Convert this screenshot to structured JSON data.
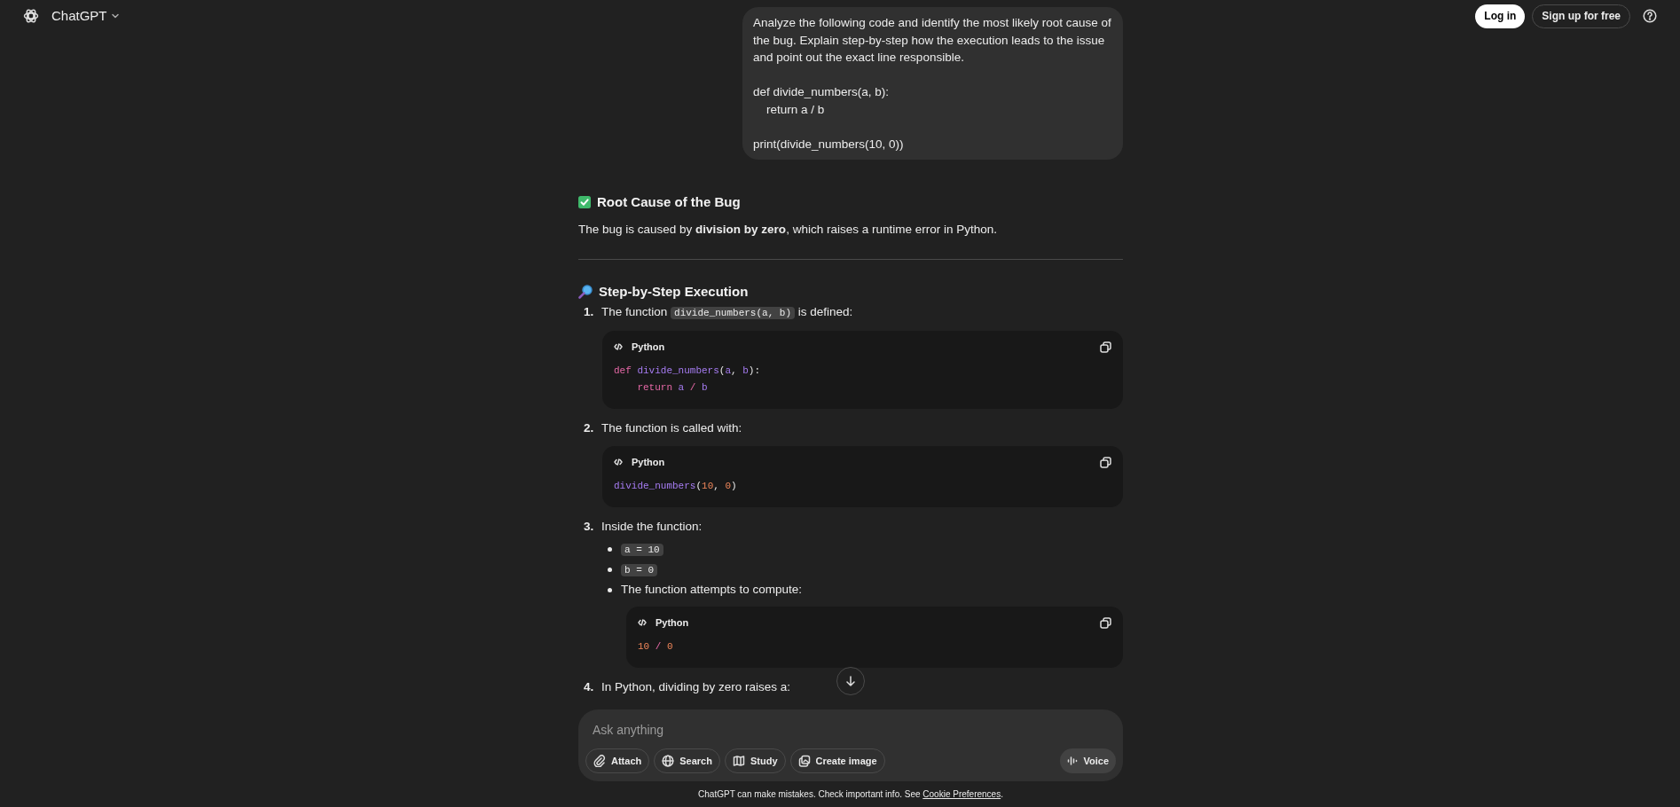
{
  "header": {
    "title": "ChatGPT",
    "login": "Log in",
    "signup": "Sign up for free"
  },
  "user_message": {
    "paragraphs": [
      "Analyze the following code and identify the most likely root cause of the bug. Explain step-by-step how the execution leads to the issue and point out the exact line responsible.",
      "def divide_numbers(a, b):\n    return a / b",
      "print(divide_numbers(10, 0))"
    ]
  },
  "sections": [
    {
      "kind": "check",
      "heading": "Root Cause of the Bug",
      "body": "The bug is caused by **division by zero**, which raises a runtime error in Python.",
      "divider": true
    },
    {
      "kind": "magnifier",
      "heading": "Step-by-Step Execution",
      "divider": false,
      "steps": [
        {
          "number": "1.",
          "parts": [
            {
              "kind": "text",
              "text": "The function "
            },
            {
              "kind": "code",
              "text": "divide_numbers(a, b)"
            },
            {
              "kind": "text",
              "text": " is defined:"
            }
          ],
          "code_block": {
            "language": "Python",
            "lines": [
              {
                "indented": false,
                "tokens": [
                  {
                    "kind": "keyword",
                    "text": "def "
                  },
                  {
                    "kind": "name",
                    "text": "divide_numbers"
                  },
                  {
                    "kind": "punct",
                    "text": "("
                  },
                  {
                    "kind": "name",
                    "text": "a"
                  },
                  {
                    "kind": "punct",
                    "text": ", "
                  },
                  {
                    "kind": "name",
                    "text": "b"
                  },
                  {
                    "kind": "punct",
                    "text": "):"
                  }
                ]
              },
              {
                "indented": true,
                "tokens": [
                  {
                    "kind": "keyword",
                    "text": "return "
                  },
                  {
                    "kind": "name",
                    "text": "a "
                  },
                  {
                    "kind": "operator",
                    "text": "/ "
                  },
                  {
                    "kind": "name",
                    "text": "b"
                  }
                ]
              }
            ]
          }
        },
        {
          "number": "2.",
          "parts": [
            {
              "kind": "text",
              "text": "The function is called with:"
            }
          ],
          "code_block": {
            "language": "Python",
            "lines": [
              {
                "indented": false,
                "tokens": [
                  {
                    "kind": "name",
                    "text": "divide_numbers"
                  },
                  {
                    "kind": "punct",
                    "text": "("
                  },
                  {
                    "kind": "number",
                    "text": "10"
                  },
                  {
                    "kind": "punct",
                    "text": ", "
                  },
                  {
                    "kind": "number",
                    "text": "0"
                  },
                  {
                    "kind": "punct",
                    "text": ")"
                  }
                ]
              }
            ]
          }
        },
        {
          "number": "3.",
          "parts": [
            {
              "kind": "text",
              "text": "Inside the function:"
            }
          ],
          "bullets": [
            {
              "parts": [
                {
                  "kind": "code",
                  "text": "a = 10"
                }
              ]
            },
            {
              "parts": [
                {
                  "kind": "code",
                  "text": "b = 0"
                }
              ]
            },
            {
              "parts": [
                {
                  "kind": "text",
                  "text": "The function attempts to compute:"
                }
              ],
              "code_block": {
                "language": "Python",
                "lines": [
                  {
                    "indented": false,
                    "tokens": [
                      {
                        "kind": "number",
                        "text": "10 "
                      },
                      {
                        "kind": "operator",
                        "text": "/ "
                      },
                      {
                        "kind": "number",
                        "text": "0"
                      }
                    ]
                  }
                ]
              }
            }
          ]
        },
        {
          "number": "4.",
          "parts": [
            {
              "kind": "text",
              "text": "In Python, dividing by zero raises a:"
            }
          ]
        }
      ]
    }
  ],
  "composer": {
    "placeholder": "Ask anything",
    "tools": [
      {
        "kind": "attach",
        "label": "Attach"
      },
      {
        "kind": "search",
        "label": "Search"
      },
      {
        "kind": "study",
        "label": "Study"
      },
      {
        "kind": "image",
        "label": "Create image"
      }
    ],
    "voice": "Voice"
  },
  "footer": {
    "text": "ChatGPT can make mistakes. Check important info. See ",
    "link": "Cookie Preferences",
    "after": "."
  }
}
